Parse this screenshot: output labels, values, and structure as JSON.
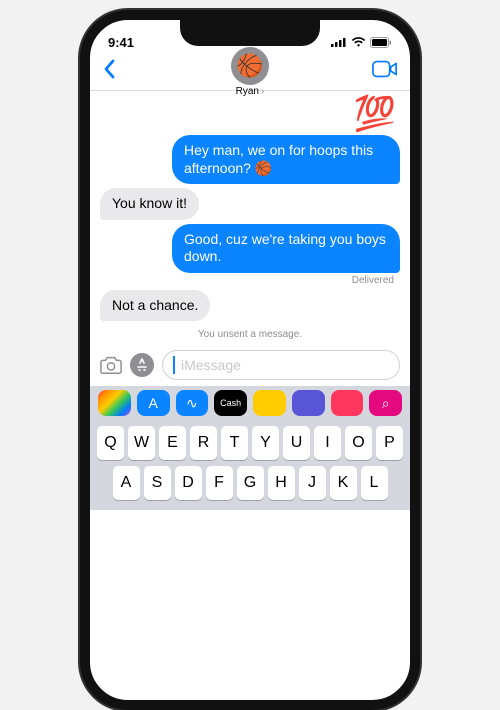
{
  "status": {
    "time": "9:41"
  },
  "contact": {
    "name": "Ryan",
    "avatar_emoji": "🏀"
  },
  "messages": {
    "m0_emoji": "💯",
    "m1": "Hey man, we on for hoops this afternoon? 🏀",
    "m2": "You know it!",
    "m3": "Good, cuz we're taking you boys down.",
    "delivered": "Delivered",
    "m4": "Not a chance.",
    "unsent": "You unsent a message."
  },
  "compose": {
    "placeholder": "iMessage"
  },
  "keyboard": {
    "row1": [
      "Q",
      "W",
      "E",
      "R",
      "T",
      "Y",
      "U",
      "I",
      "O",
      "P"
    ],
    "row2": [
      "A",
      "S",
      "D",
      "F",
      "G",
      "H",
      "J",
      "K",
      "L"
    ]
  },
  "app_strip_count": 8
}
